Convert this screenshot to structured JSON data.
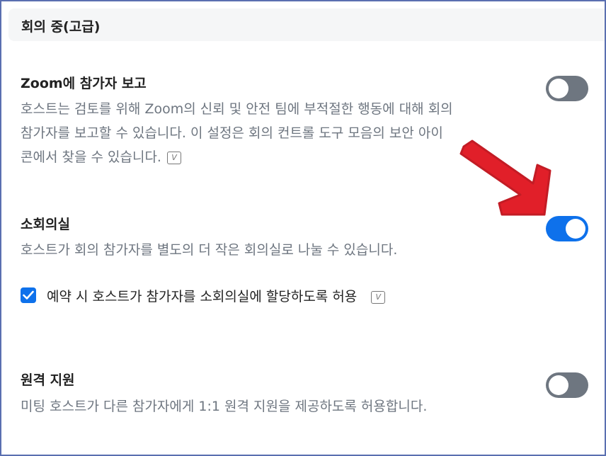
{
  "section": {
    "title": "회의 중(고급)"
  },
  "settings": [
    {
      "title": "Zoom에 참가자 보고",
      "description_lines": [
        "호스트는 검토를 위해 Zoom의 신뢰 및 안전 팀에 부적절한 행동에 대해 회의",
        "참가자를 보고할 수 있습니다. 이 설정은 회의 컨트롤 도구 모음의 보안 아이",
        "콘에서 찾을 수 있습니다."
      ],
      "enabled": false
    },
    {
      "title": "소회의실",
      "description": "호스트가 회의 참가자를 별도의 더 작은 회의실로 나눌 수 있습니다.",
      "enabled": true,
      "sub_option": {
        "label": "예약 시 호스트가 참가자를 소회의실에 할당하도록 허용",
        "checked": true
      }
    },
    {
      "title": "원격 지원",
      "description": "미팅 호스트가 다른 참가자에게 1:1 원격 지원을 제공하도록 허용합니다.",
      "enabled": false
    }
  ],
  "icons": {
    "info": "v-info-icon",
    "check": "check-icon",
    "annotation": "red-arrow-annotation"
  },
  "colors": {
    "toggle_on": "#0e71eb",
    "toggle_off": "#6e7680",
    "text_primary": "#222222",
    "text_secondary": "#6e7680",
    "annotation": "#e0141e"
  }
}
